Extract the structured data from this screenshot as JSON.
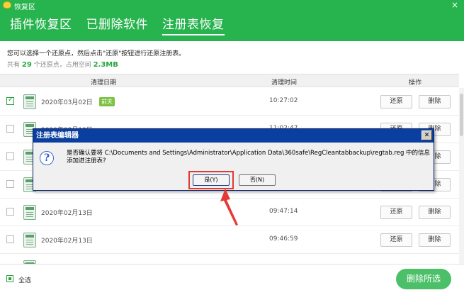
{
  "window": {
    "title": "恢复区",
    "close_label": "×"
  },
  "tabs": [
    {
      "label": "插件恢复区",
      "active": false
    },
    {
      "label": "已删除软件",
      "active": false
    },
    {
      "label": "注册表恢复",
      "active": true
    }
  ],
  "info": {
    "instruction": "您可以选择一个还原点，然后点击\"还原\"按钮进行还原注册表。",
    "summary_prefix": "共有",
    "restore_count": "29",
    "summary_mid": "个还原点，占用空间",
    "space_used": "2.3MB"
  },
  "table": {
    "headers": {
      "date": "清理日期",
      "time": "清理时间",
      "action": "操作"
    },
    "rows": [
      {
        "date": "2020年03月02日",
        "badge": "前天",
        "time": "10:27:02",
        "checked": true
      },
      {
        "date": "2020年02月19日",
        "badge": "",
        "time": "11:02:47",
        "checked": false
      },
      {
        "date": "",
        "badge": "",
        "time": "",
        "checked": false
      },
      {
        "date": "",
        "badge": "",
        "time": "",
        "checked": false
      },
      {
        "date": "2020年02月13日",
        "badge": "",
        "time": "09:47:14",
        "checked": false
      },
      {
        "date": "2020年02月13日",
        "badge": "",
        "time": "09:46:59",
        "checked": false
      }
    ],
    "restore_label": "还原",
    "delete_label": "删除"
  },
  "footer": {
    "select_all": "全选",
    "delete_selected": "删除所选"
  },
  "dialog": {
    "title": "注册表编辑器",
    "close_label": "✕",
    "icon": "question-icon",
    "icon_glyph": "?",
    "message": "是否确认要将 C:\\Documents and Settings\\Administrator\\Application Data\\360safe\\RegCleantabbackup\\regtab.reg 中的信息添加进注册表?",
    "yes_label": "是(Y)",
    "no_label": "否(N)"
  },
  "colors": {
    "accent": "#27b34e",
    "dialog_title": "#0a3fa0",
    "highlight": "#e53935"
  }
}
